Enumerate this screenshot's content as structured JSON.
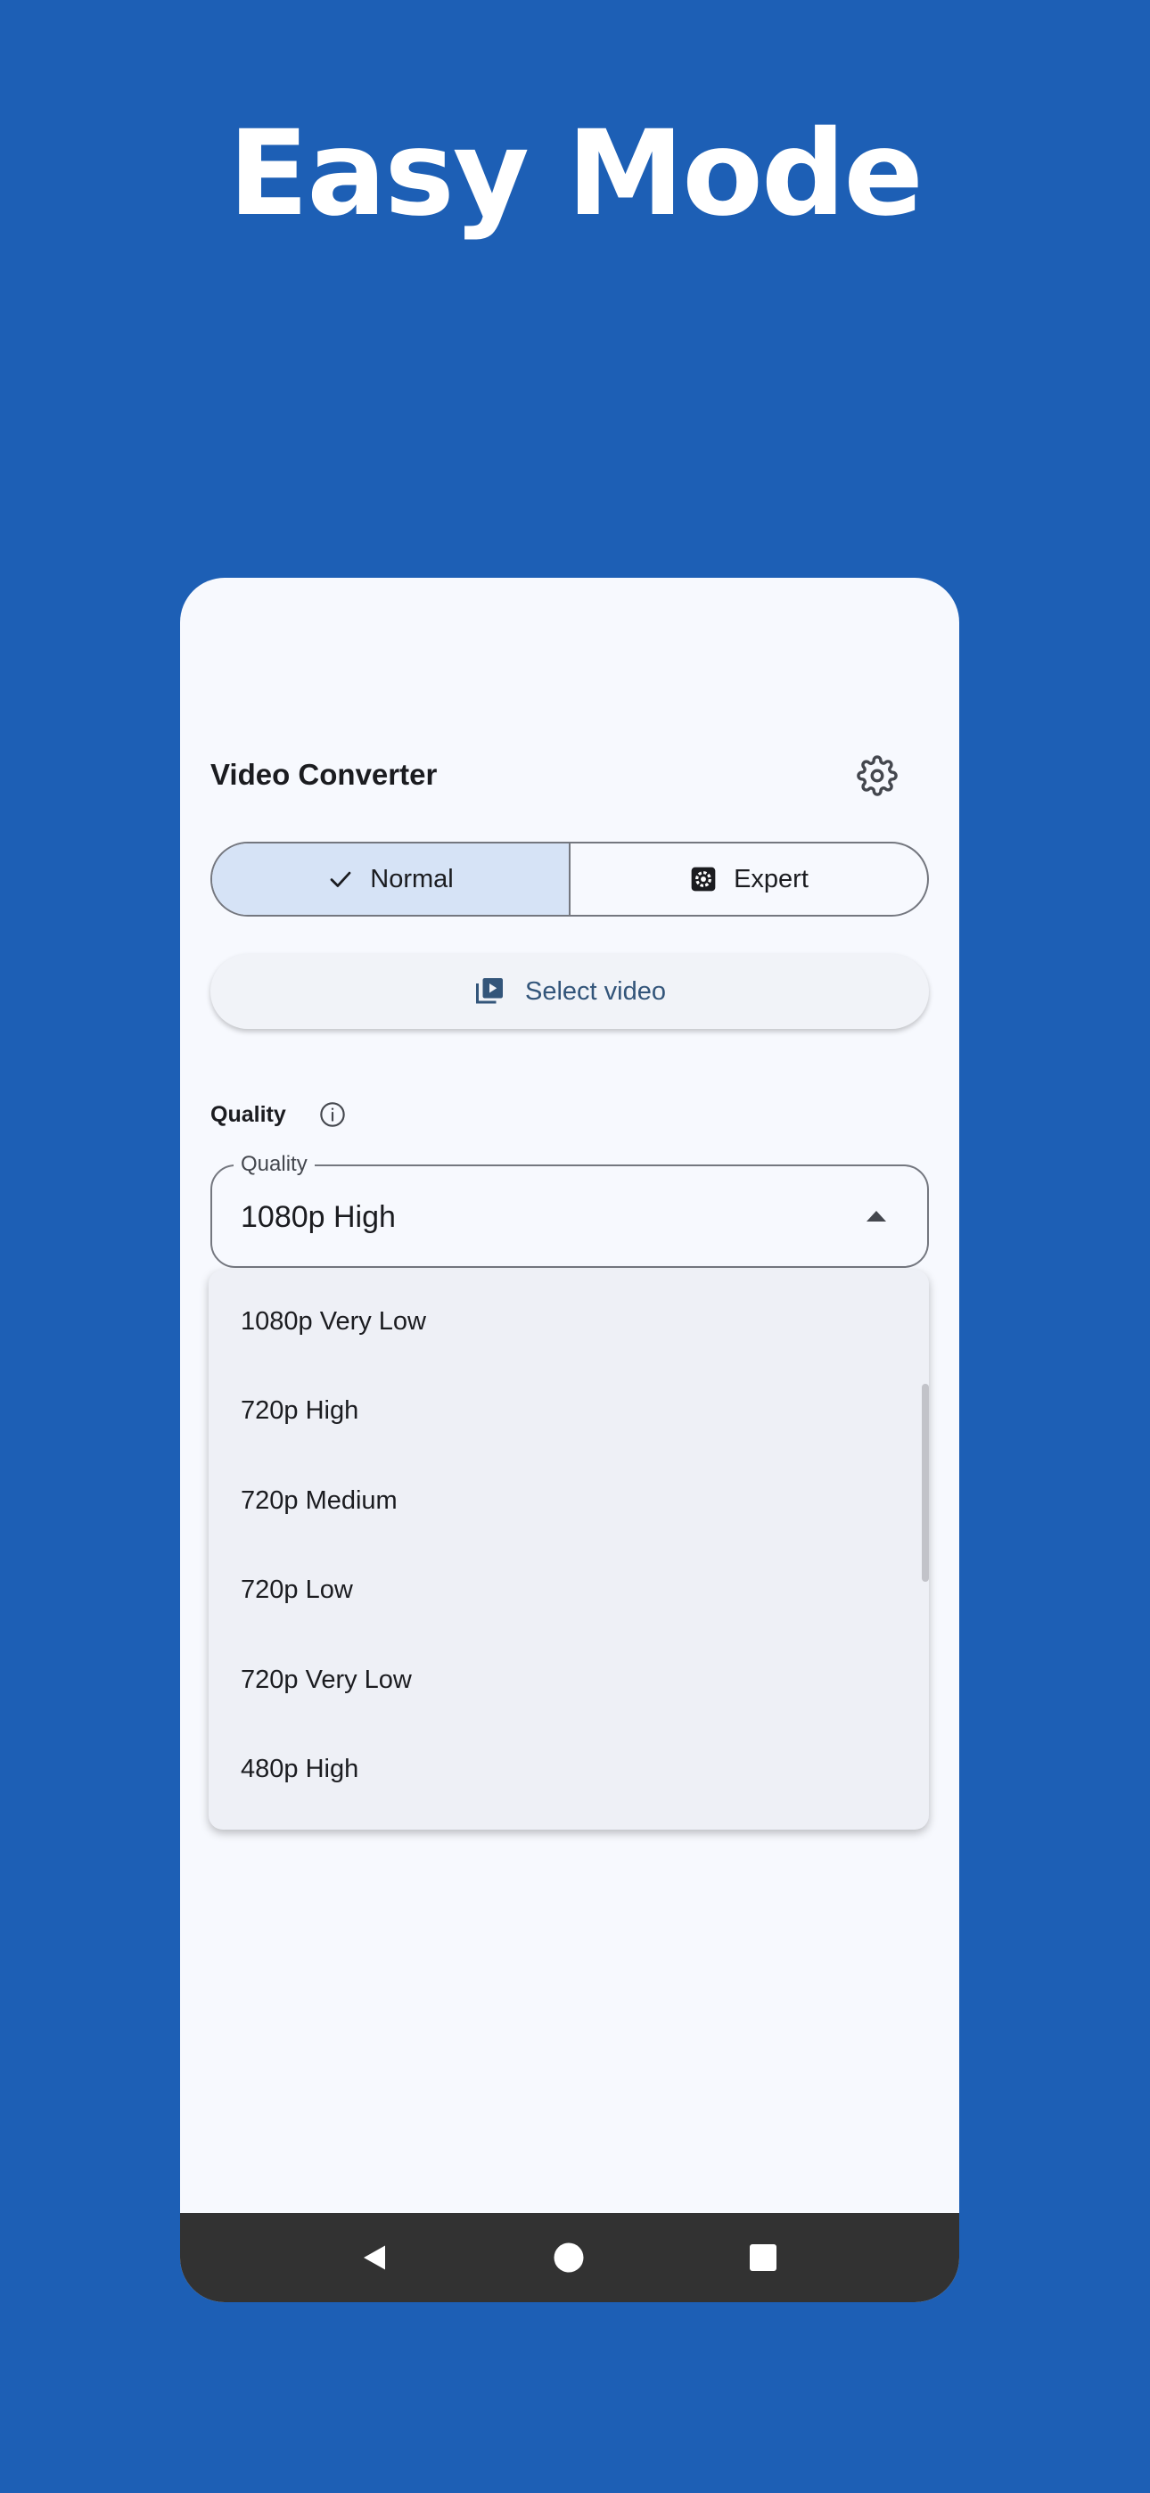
{
  "headline": "Easy Mode",
  "app": {
    "title": "Video Converter",
    "settings_icon": "gear-icon"
  },
  "mode_toggle": {
    "normal_label": "Normal",
    "expert_label": "Expert",
    "selected": "Normal"
  },
  "select_video": {
    "label": "Select video",
    "icon": "video-library-icon"
  },
  "quality_section": {
    "label": "Quality",
    "info_icon": "info-icon"
  },
  "quality_dropdown": {
    "floating_label": "Quality",
    "value": "1080p High",
    "expanded": true
  },
  "quality_menu": {
    "items": [
      "1080p Very Low",
      "720p High",
      "720p Medium",
      "720p Low",
      "720p Very Low",
      "480p High"
    ]
  },
  "colors": {
    "background": "#1d5fb5",
    "surface": "#f7f9fe",
    "selected_segment": "#d6e3f6",
    "primary_text": "#33557a",
    "navbar": "#323232"
  },
  "navbar": {
    "back_icon": "back-triangle-icon",
    "home_icon": "home-circle-icon",
    "recents_icon": "recents-square-icon"
  }
}
